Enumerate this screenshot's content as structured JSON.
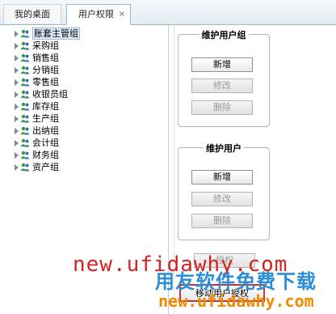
{
  "tabs": {
    "desktop": "我的桌面",
    "permissions": "用户权限",
    "close_glyph": "×"
  },
  "tree": {
    "items": [
      {
        "label": "账套主管组",
        "selected": true
      },
      {
        "label": "采购组"
      },
      {
        "label": "销售组"
      },
      {
        "label": "分销组"
      },
      {
        "label": "零售组"
      },
      {
        "label": "收银员组"
      },
      {
        "label": "库存组"
      },
      {
        "label": "生产组"
      },
      {
        "label": "出纳组"
      },
      {
        "label": "会计组"
      },
      {
        "label": "财务组"
      },
      {
        "label": "资产组"
      }
    ],
    "icon": "user-group-icon"
  },
  "group_panel": {
    "title": "维护用户组",
    "add": "新增",
    "edit": "修改",
    "delete": "删除"
  },
  "user_panel": {
    "title": "维护用户",
    "add": "新增",
    "edit": "修改",
    "delete": "删除"
  },
  "actions": {
    "grant": "授权",
    "move": "移动用户授权"
  },
  "watermarks": {
    "url_red": "new.ufidawhy.com",
    "text_blue": "用友软件免费下载",
    "url_orange": "new.ufidawhy.com"
  },
  "colors": {
    "accent_blue": "#2a8fd8",
    "watermark_red": "#d92020",
    "watermark_orange": "#f08a00",
    "highlight_border": "#d03030"
  }
}
